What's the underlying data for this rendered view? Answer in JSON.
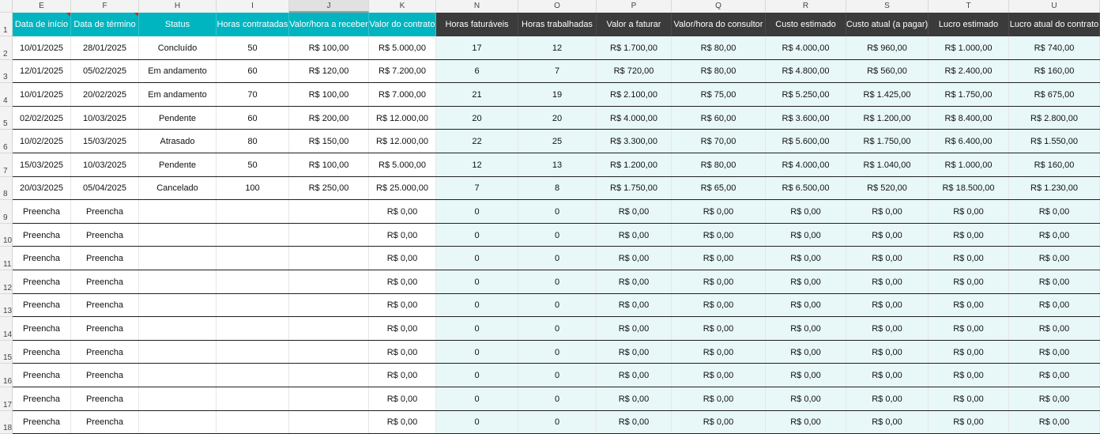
{
  "columns": [
    "E",
    "F",
    "H",
    "I",
    "J",
    "K",
    "N",
    "O",
    "P",
    "Q",
    "R",
    "S",
    "T",
    "U"
  ],
  "selected_column": "J",
  "headers": [
    "Data de início",
    "Data de término",
    "Status",
    "Horas contratadas",
    "Valor/hora a receber",
    "Valor do contrato",
    "Horas faturáveis",
    "Horas trabalhadas",
    "Valor a faturar",
    "Valor/hora do consultor",
    "Custo estimado",
    "Custo atual (a pagar)",
    "Lucro estimado",
    "Lucro atual do contrato"
  ],
  "row_numbers": [
    "1",
    "2",
    "3",
    "4",
    "5",
    "6",
    "7",
    "8",
    "9",
    "10",
    "11",
    "12",
    "13",
    "14",
    "15",
    "16",
    "17",
    "18"
  ],
  "rows": [
    [
      "10/01/2025",
      "28/01/2025",
      "Concluído",
      "50",
      "R$ 100,00",
      "R$ 5.000,00",
      "17",
      "12",
      "R$ 1.700,00",
      "R$ 80,00",
      "R$ 4.000,00",
      "R$ 960,00",
      "R$ 1.000,00",
      "R$ 740,00"
    ],
    [
      "12/01/2025",
      "05/02/2025",
      "Em andamento",
      "60",
      "R$ 120,00",
      "R$ 7.200,00",
      "6",
      "7",
      "R$ 720,00",
      "R$ 80,00",
      "R$ 4.800,00",
      "R$ 560,00",
      "R$ 2.400,00",
      "R$ 160,00"
    ],
    [
      "10/01/2025",
      "20/02/2025",
      "Em andamento",
      "70",
      "R$ 100,00",
      "R$ 7.000,00",
      "21",
      "19",
      "R$ 2.100,00",
      "R$ 75,00",
      "R$ 5.250,00",
      "R$ 1.425,00",
      "R$ 1.750,00",
      "R$ 675,00"
    ],
    [
      "02/02/2025",
      "10/03/2025",
      "Pendente",
      "60",
      "R$ 200,00",
      "R$ 12.000,00",
      "20",
      "20",
      "R$ 4.000,00",
      "R$ 60,00",
      "R$ 3.600,00",
      "R$ 1.200,00",
      "R$ 8.400,00",
      "R$ 2.800,00"
    ],
    [
      "10/02/2025",
      "15/03/2025",
      "Atrasado",
      "80",
      "R$ 150,00",
      "R$ 12.000,00",
      "22",
      "25",
      "R$ 3.300,00",
      "R$ 70,00",
      "R$ 5.600,00",
      "R$ 1.750,00",
      "R$ 6.400,00",
      "R$ 1.550,00"
    ],
    [
      "15/03/2025",
      "10/03/2025",
      "Pendente",
      "50",
      "R$ 100,00",
      "R$ 5.000,00",
      "12",
      "13",
      "R$ 1.200,00",
      "R$ 80,00",
      "R$ 4.000,00",
      "R$ 1.040,00",
      "R$ 1.000,00",
      "R$ 160,00"
    ],
    [
      "20/03/2025",
      "05/04/2025",
      "Cancelado",
      "100",
      "R$ 250,00",
      "R$ 25.000,00",
      "7",
      "8",
      "R$ 1.750,00",
      "R$ 65,00",
      "R$ 6.500,00",
      "R$ 520,00",
      "R$ 18.500,00",
      "R$ 1.230,00"
    ],
    [
      "Preencha",
      "Preencha",
      "",
      "",
      "",
      "R$ 0,00",
      "0",
      "0",
      "R$ 0,00",
      "R$ 0,00",
      "R$ 0,00",
      "R$ 0,00",
      "R$ 0,00",
      "R$ 0,00"
    ],
    [
      "Preencha",
      "Preencha",
      "",
      "",
      "",
      "R$ 0,00",
      "0",
      "0",
      "R$ 0,00",
      "R$ 0,00",
      "R$ 0,00",
      "R$ 0,00",
      "R$ 0,00",
      "R$ 0,00"
    ],
    [
      "Preencha",
      "Preencha",
      "",
      "",
      "",
      "R$ 0,00",
      "0",
      "0",
      "R$ 0,00",
      "R$ 0,00",
      "R$ 0,00",
      "R$ 0,00",
      "R$ 0,00",
      "R$ 0,00"
    ],
    [
      "Preencha",
      "Preencha",
      "",
      "",
      "",
      "R$ 0,00",
      "0",
      "0",
      "R$ 0,00",
      "R$ 0,00",
      "R$ 0,00",
      "R$ 0,00",
      "R$ 0,00",
      "R$ 0,00"
    ],
    [
      "Preencha",
      "Preencha",
      "",
      "",
      "",
      "R$ 0,00",
      "0",
      "0",
      "R$ 0,00",
      "R$ 0,00",
      "R$ 0,00",
      "R$ 0,00",
      "R$ 0,00",
      "R$ 0,00"
    ],
    [
      "Preencha",
      "Preencha",
      "",
      "",
      "",
      "R$ 0,00",
      "0",
      "0",
      "R$ 0,00",
      "R$ 0,00",
      "R$ 0,00",
      "R$ 0,00",
      "R$ 0,00",
      "R$ 0,00"
    ],
    [
      "Preencha",
      "Preencha",
      "",
      "",
      "",
      "R$ 0,00",
      "0",
      "0",
      "R$ 0,00",
      "R$ 0,00",
      "R$ 0,00",
      "R$ 0,00",
      "R$ 0,00",
      "R$ 0,00"
    ],
    [
      "Preencha",
      "Preencha",
      "",
      "",
      "",
      "R$ 0,00",
      "0",
      "0",
      "R$ 0,00",
      "R$ 0,00",
      "R$ 0,00",
      "R$ 0,00",
      "R$ 0,00",
      "R$ 0,00"
    ],
    [
      "Preencha",
      "Preencha",
      "",
      "",
      "",
      "R$ 0,00",
      "0",
      "0",
      "R$ 0,00",
      "R$ 0,00",
      "R$ 0,00",
      "R$ 0,00",
      "R$ 0,00",
      "R$ 0,00"
    ],
    [
      "Preencha",
      "Preencha",
      "",
      "",
      "",
      "R$ 0,00",
      "0",
      "0",
      "R$ 0,00",
      "R$ 0,00",
      "R$ 0,00",
      "R$ 0,00",
      "R$ 0,00",
      "R$ 0,00"
    ]
  ],
  "colors": {
    "teal_header": "#00b5c0",
    "dark_header": "#3b3b3b",
    "light_fill": "#e8f8f8",
    "comment_marker": "#d92020"
  }
}
